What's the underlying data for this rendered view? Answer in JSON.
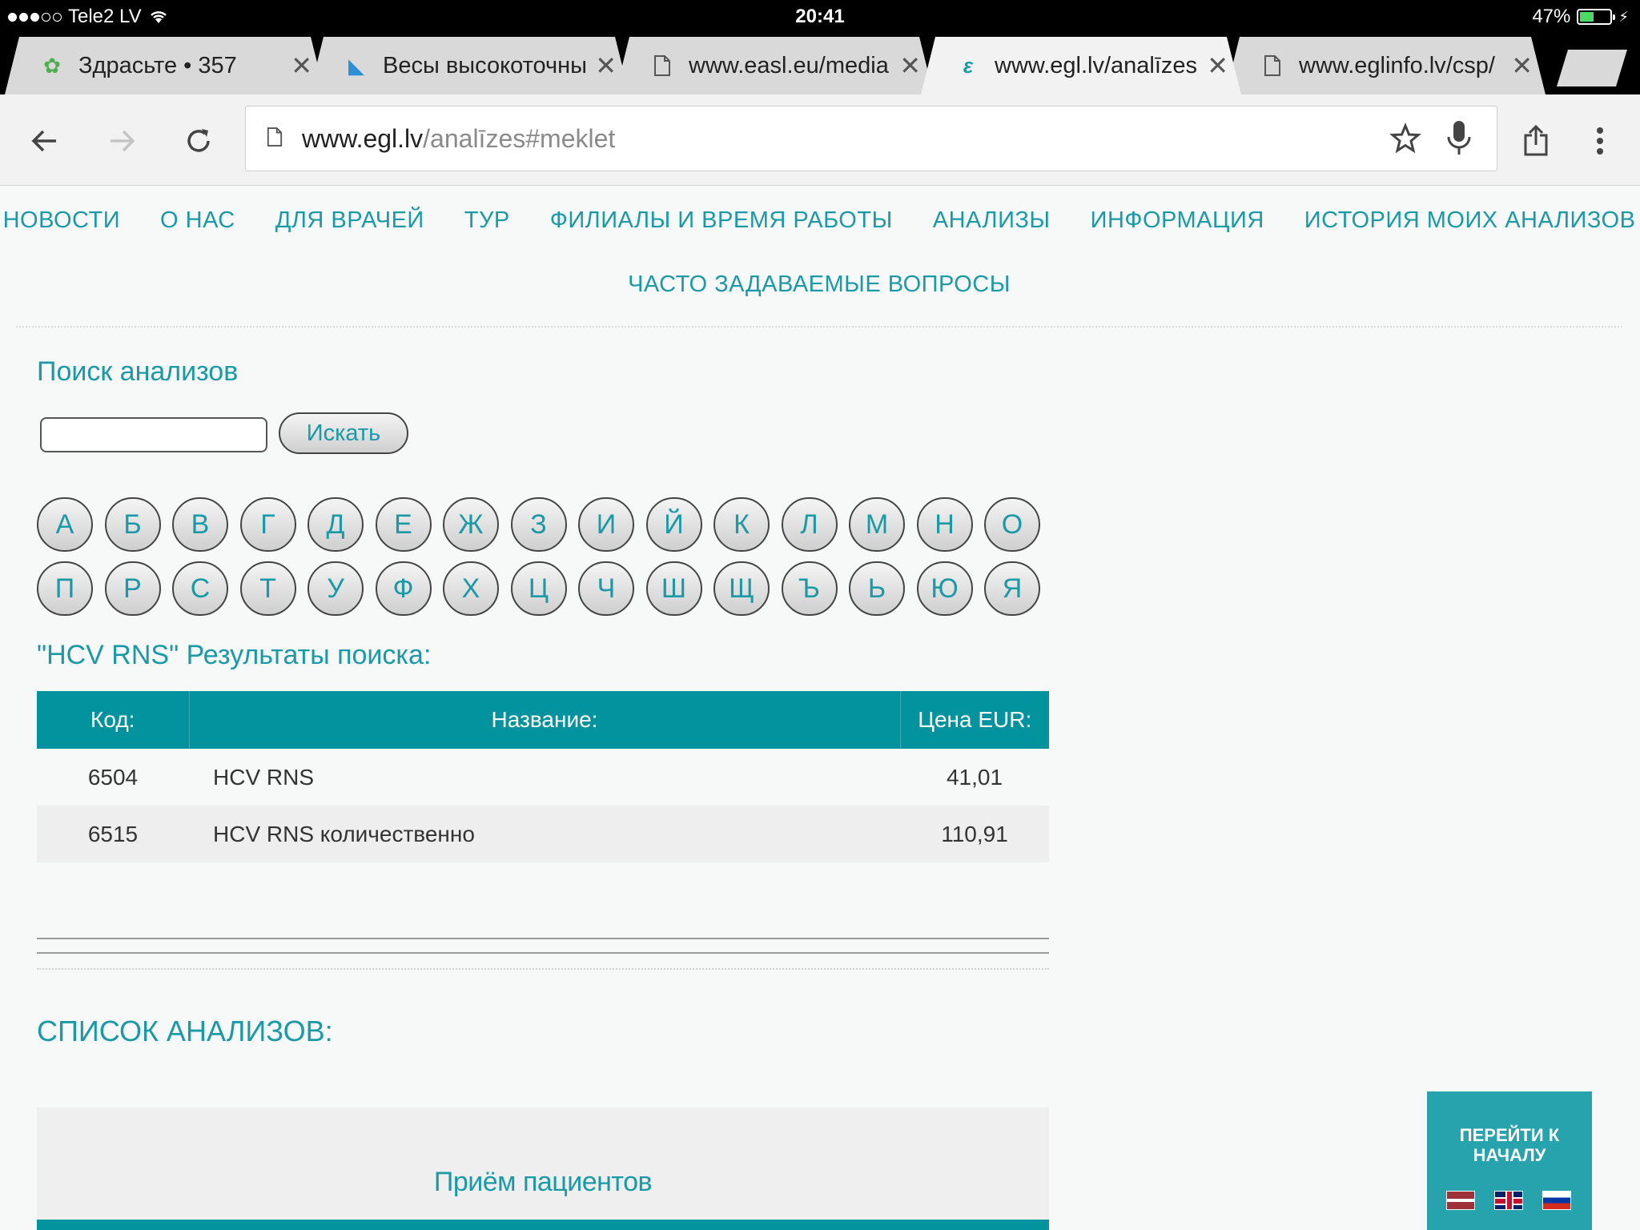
{
  "status_bar": {
    "carrier": "Tele2 LV",
    "time": "20:41",
    "battery_percent": "47%",
    "battery_level": 0.47
  },
  "tabs": [
    {
      "title": "Здрасьте • 357",
      "icon": "leaf-favicon"
    },
    {
      "title": "Весы высокоточные",
      "icon": "scale-favicon"
    },
    {
      "title": "www.easl.eu/media",
      "icon": "page-icon"
    },
    {
      "title": "www.egl.lv/analīzes",
      "icon": "egl-favicon"
    },
    {
      "title": "www.eglinfo.lv/csp/",
      "icon": "page-icon"
    }
  ],
  "toolbar": {
    "url_host": "www.egl.lv",
    "url_path": "/analīzes#meklet",
    "icons": [
      "back-icon",
      "forward-icon",
      "reload-icon",
      "star-icon",
      "mic-icon",
      "share-icon",
      "menu-icon"
    ]
  },
  "nav": {
    "row1": [
      "НОВОСТИ",
      "О НАС",
      "ДЛЯ ВРАЧЕЙ",
      "ТУР",
      "ФИЛИАЛЫ И ВРЕМЯ РАБОТЫ",
      "АНАЛИЗЫ",
      "ИНФОРМАЦИЯ",
      "ИСТОРИЯ МОИХ АНАЛИЗОВ"
    ],
    "row2": [
      "ЧАСТО ЗАДАВАЕМЫЕ ВОПРОСЫ"
    ]
  },
  "search": {
    "title": "Поиск анализов",
    "input_value": "",
    "button_label": "Искать"
  },
  "alphabet": {
    "row1": [
      "А",
      "Б",
      "В",
      "Г",
      "Д",
      "Е",
      "Ж",
      "З",
      "И",
      "Й",
      "К",
      "Л",
      "М",
      "Н",
      "О"
    ],
    "row2": [
      "П",
      "Р",
      "С",
      "Т",
      "У",
      "Ф",
      "Х",
      "Ц",
      "Ч",
      "Ш",
      "Щ",
      "Ъ",
      "Ь",
      "Ю",
      "Я"
    ]
  },
  "results": {
    "title": "\"HCV RNS\" Результаты поиска:",
    "headers": {
      "code": "Код:",
      "name": "Название:",
      "price": "Цена EUR:"
    },
    "rows": [
      {
        "code": "6504",
        "name": "HCV RNS",
        "price": "41,01"
      },
      {
        "code": "6515",
        "name": "HCV RNS количественно",
        "price": "110,91"
      }
    ]
  },
  "list": {
    "title": "СПИСОК АНАЛИЗОВ:",
    "category": "Приём пациентов"
  },
  "to_top": {
    "label_line1": "ПЕРЕЙТИ К",
    "label_line2": "НАЧАЛУ"
  },
  "colors": {
    "accent": "#1a9aa7",
    "table_header": "#03939f",
    "to_top_bg": "#26a3ac"
  }
}
